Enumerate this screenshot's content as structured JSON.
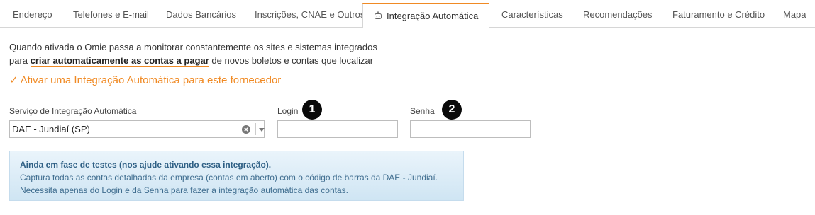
{
  "tabs": [
    {
      "label": "Endereço"
    },
    {
      "label": "Telefones e E-mail"
    },
    {
      "label": "Dados Bancários"
    },
    {
      "label": "Inscrições, CNAE e Outros"
    },
    {
      "label": "Integração Automática",
      "active": true,
      "icon": "robot-icon"
    },
    {
      "label": "Características"
    },
    {
      "label": "Recomendações"
    },
    {
      "label": "Faturamento e Crédito"
    },
    {
      "label": "Mapa"
    }
  ],
  "intro": {
    "line1": "Quando ativada o Omie passa a monitorar constantemente os sites e sistemas integrados",
    "line2_pre": "para ",
    "line2_bold": "criar automaticamente as contas a pagar",
    "line2_post": " de novos boletos e contas que localizar"
  },
  "activate": {
    "check": "✓",
    "label": "Ativar uma Integração Automática para este fornecedor"
  },
  "form": {
    "service_label": "Serviço de Integração Automática",
    "service_value": "DAE - Jundiaí (SP)",
    "login_label": "Login",
    "login_value": "",
    "password_label": "Senha",
    "password_value": "",
    "badge1": "1",
    "badge2": "2"
  },
  "info": {
    "title": "Ainda em fase de testes (nos ajude ativando essa integração).",
    "line1": "Captura todas as contas detalhadas da empresa (contas em aberto) com o código de barras da DAE - Jundiaí.",
    "line2": "Necessita apenas do Login e da Senha para fazer a integração automática das contas."
  },
  "colors": {
    "accent": "#f08a24",
    "info_text": "#3f6d8f",
    "info_bg": "#d8ebf7"
  }
}
